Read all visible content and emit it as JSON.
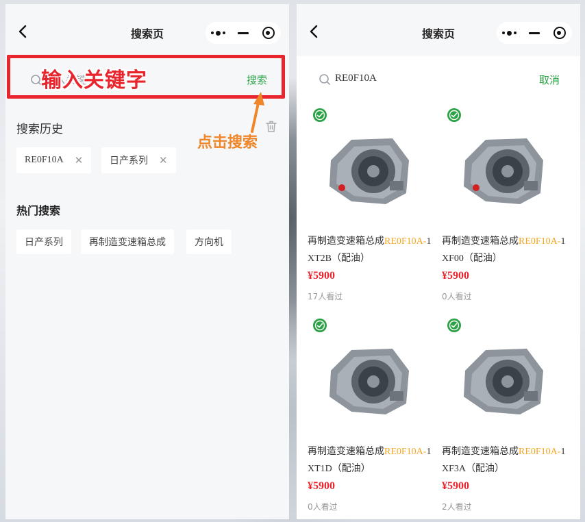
{
  "left": {
    "nav_title": "搜索页",
    "search_placeholder": "输入关键字",
    "search_button": "搜索",
    "annotation_input": "输入关键字",
    "annotation_click": "点击搜索",
    "history_title": "搜索历史",
    "history": [
      "RE0F10A",
      "日产系列"
    ],
    "hot_title": "热门搜索",
    "hot": [
      "日产系列",
      "再制造变速箱总成",
      "方向机"
    ]
  },
  "right": {
    "nav_title": "搜索页",
    "search_value": "RE0F10A",
    "cancel_button": "取消",
    "products": [
      {
        "name_prefix": "再制造变速箱总成",
        "name_hl": "RE0F10A-",
        "name_model": "1XT2B",
        "name_suffix": "（配油）",
        "price": "¥5900",
        "views": "17人看过"
      },
      {
        "name_prefix": "再制造变速箱总成",
        "name_hl": "RE0F10A-",
        "name_model": "1XF00",
        "name_suffix": "（配油）",
        "price": "¥5900",
        "views": "0人看过"
      },
      {
        "name_prefix": "再制造变速箱总成",
        "name_hl": "RE0F10A-",
        "name_model": "1XT1D",
        "name_suffix": "（配油）",
        "price": "¥5900",
        "views": "0人看过"
      },
      {
        "name_prefix": "再制造变速箱总成",
        "name_hl": "RE0F10A-",
        "name_model": "1XF3A",
        "name_suffix": "（配油）",
        "price": "¥5900",
        "views": "2人看过"
      }
    ]
  },
  "colors": {
    "accent_green": "#2ba245",
    "annotation_red": "#e8242c",
    "annotation_orange": "#f0862a",
    "highlight_orange": "#f5a623",
    "price_red": "#e8242c"
  },
  "icons": [
    "back-icon",
    "more-dots-icon",
    "minimize-icon",
    "close-target-icon",
    "search-icon",
    "trash-icon",
    "close-x-icon",
    "certified-badge-icon",
    "arrow-annotation"
  ]
}
